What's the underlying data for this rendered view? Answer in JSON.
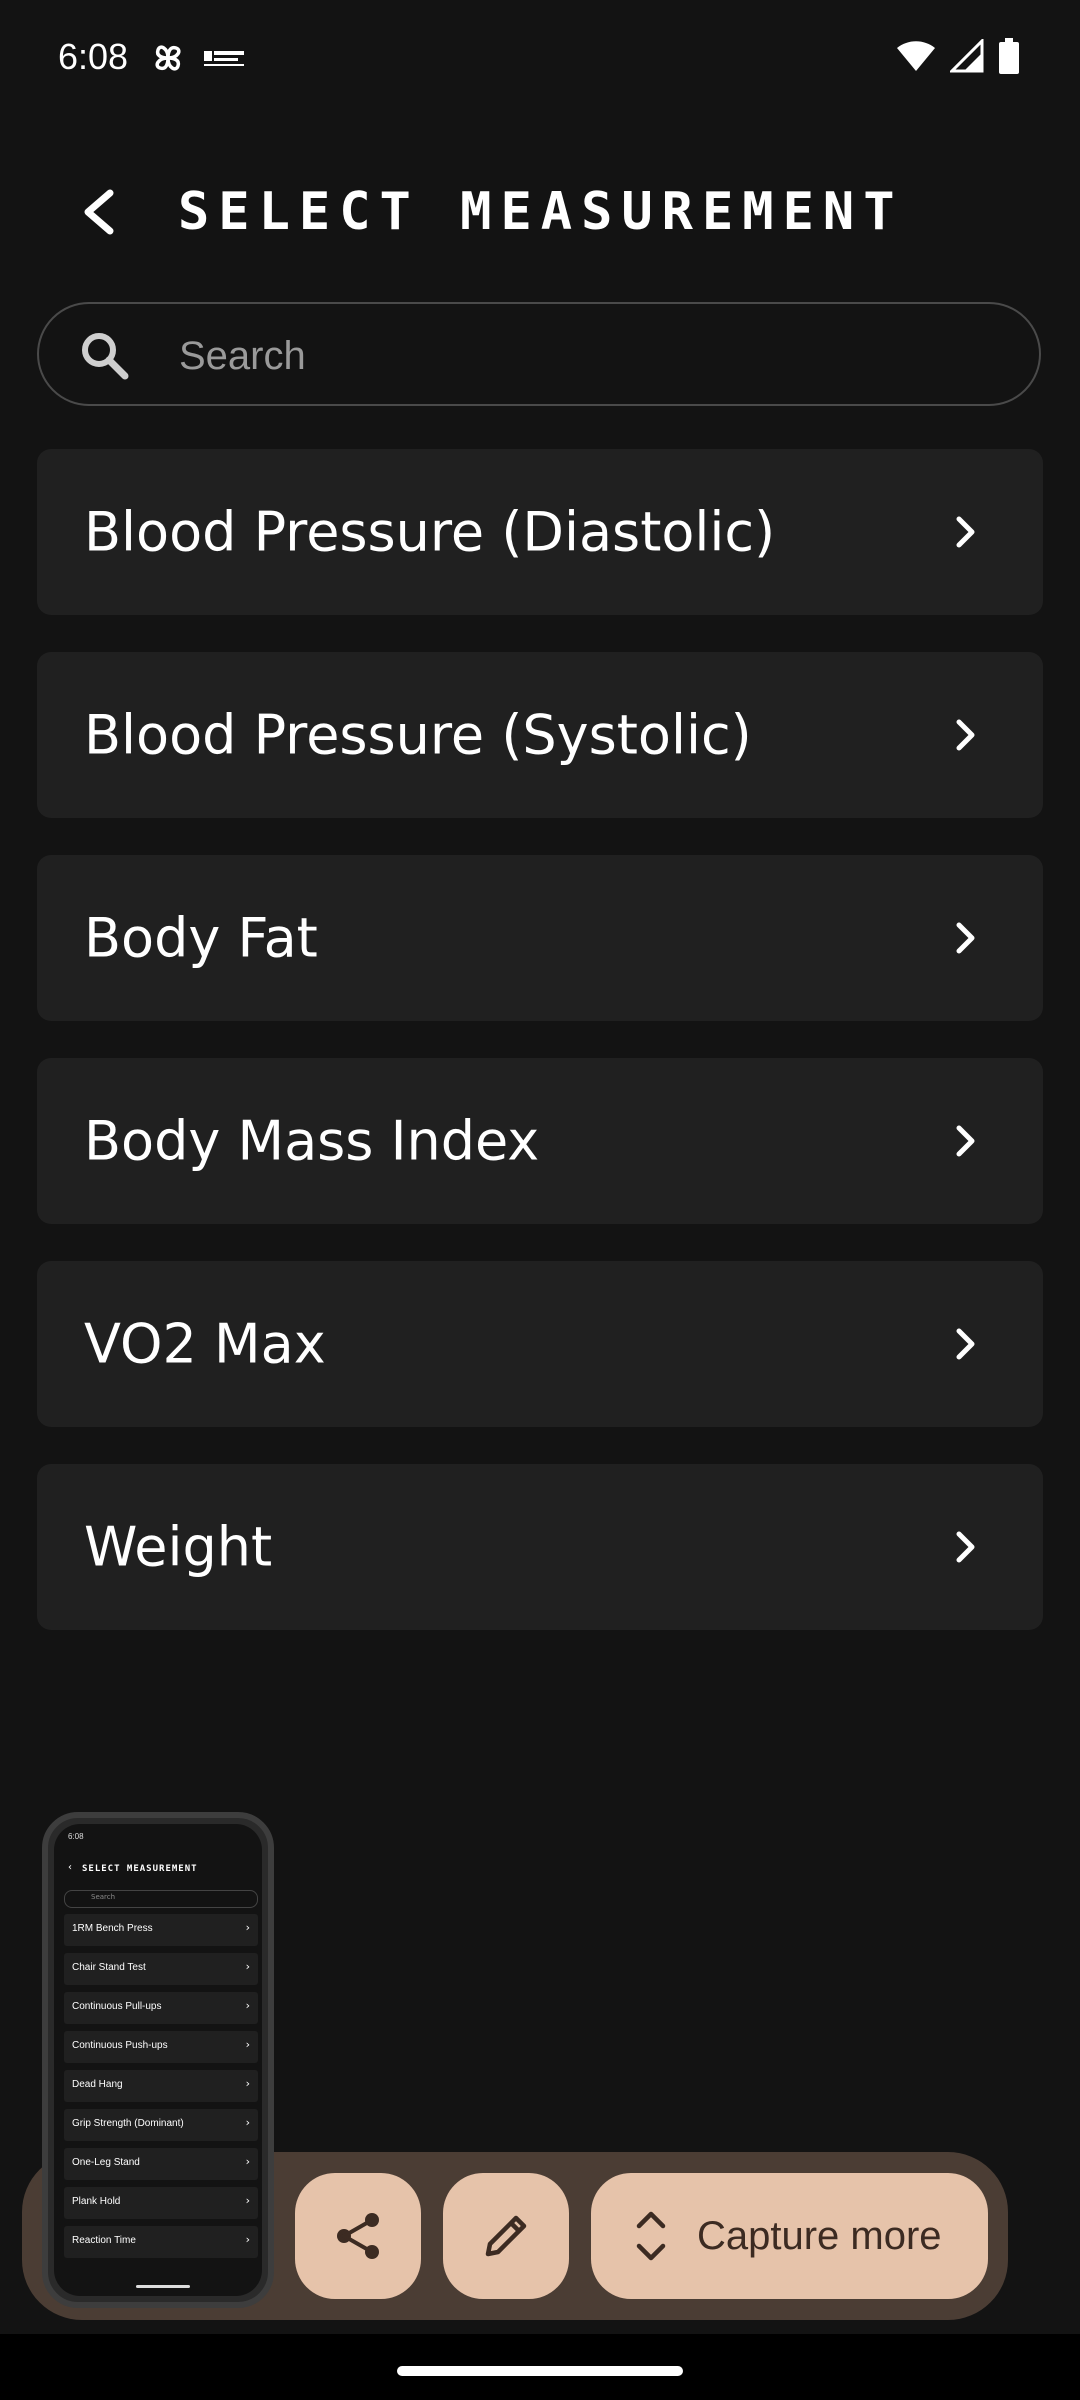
{
  "status_bar": {
    "time": "6:08",
    "left_icons": [
      "pinwheel-icon",
      "app-notification-icon"
    ],
    "right_icons": [
      "wifi-icon",
      "cellular-signal-icon",
      "battery-icon"
    ]
  },
  "header": {
    "back_icon": "arrow-back-icon",
    "title": "SELECT MEASUREMENT"
  },
  "search": {
    "icon": "search-icon",
    "placeholder": "Search",
    "value": ""
  },
  "measurements": [
    {
      "label": "Blood Pressure (Diastolic)"
    },
    {
      "label": "Blood Pressure (Systolic)"
    },
    {
      "label": "Body Fat"
    },
    {
      "label": "Body Mass Index"
    },
    {
      "label": "VO2 Max"
    },
    {
      "label": "Weight"
    }
  ],
  "screenshot_preview": {
    "status_time": "6:08",
    "title": "SELECT MEASUREMENT",
    "search_placeholder": "Search",
    "items": [
      "1RM Bench Press",
      "Chair Stand Test",
      "Continuous Pull-ups",
      "Continuous Push-ups",
      "Dead Hang",
      "Grip Strength (Dominant)",
      "One-Leg Stand",
      "Plank Hold",
      "Reaction Time"
    ]
  },
  "screenshot_toolbar": {
    "share_icon": "share-icon",
    "edit_icon": "pencil-icon",
    "capture_icon": "expand-vertical-icon",
    "capture_label": "Capture more",
    "colors": {
      "bar": "#4b3d34",
      "button": "#e6c3aa",
      "button_text": "#3c2b22"
    }
  },
  "colors": {
    "background": "#131313",
    "card": "#202020",
    "text": "#ffffff"
  }
}
